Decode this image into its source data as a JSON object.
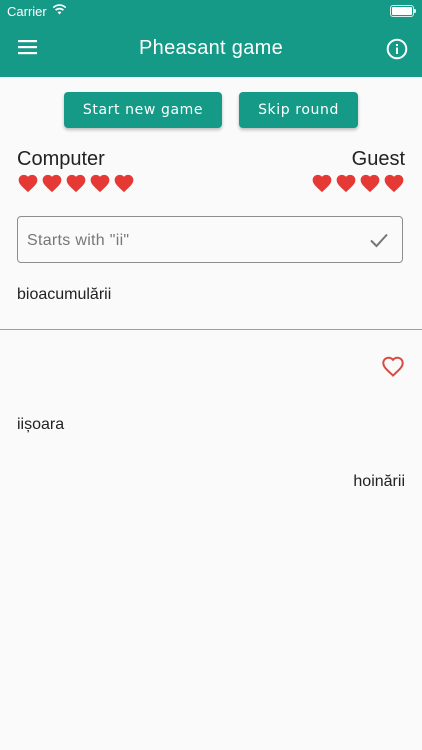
{
  "status_bar": {
    "carrier": "Carrier"
  },
  "app_bar": {
    "title": "Pheasant game",
    "menu_icon": "menu-icon",
    "info_icon": "info-icon"
  },
  "actions": {
    "new_game": "Start new game",
    "skip_round": "Skip round"
  },
  "players": {
    "left": {
      "name": "Computer",
      "lives": 5
    },
    "right": {
      "name": "Guest",
      "lives": 4
    }
  },
  "input": {
    "placeholder": "Starts with \"ii\"",
    "value": "",
    "submit_icon": "check-icon"
  },
  "words": {
    "current": "bioacumulării",
    "history": [
      "iișoara",
      "hoinării"
    ]
  },
  "colors": {
    "primary": "#149a87",
    "heart": "#e53935"
  }
}
